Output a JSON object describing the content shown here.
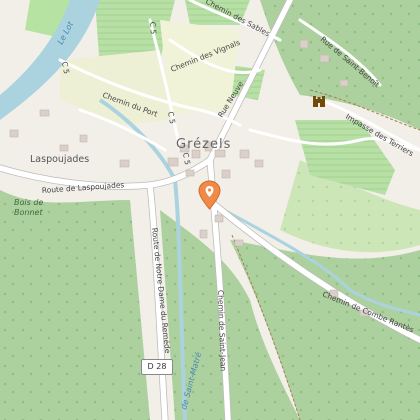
{
  "labels": {
    "village": "Grézels",
    "laspoujades": "Laspoujades",
    "bois_de_bonnet_1": "Bois de",
    "bois_de_bonnet_2": "Bonnet",
    "route_laspoujades": "Route de Laspoujades",
    "route_notre_dame": "Route de Notre Dame du Reméde",
    "chemin_port": "Chemin du Port",
    "rue_neuve": "Rue Neuve",
    "chemin_vignals": "Chemin des Vignals",
    "chemin_sables": "Chemin des Sables",
    "rue_st_benoit": "Rue de Saint-Benoît",
    "impasse_terriers": "Impasse des Terriers",
    "chemin_st_jean": "Chemin de Saint-Jean",
    "chemin_combe": "Chemin de Combe Rantès",
    "c5_a": "C 5",
    "c5_b": "C 5",
    "c5_c": "C 5",
    "c5_d": "C 5",
    "lot": "Le Lot",
    "stream": "de Saint-Matré",
    "road_shield": "D 28"
  },
  "icons": {
    "location_pin": "location-pin-icon",
    "castle": "castle-icon"
  },
  "colors": {
    "forest": "#aed1a0",
    "vineyard": "#b6e3a2",
    "farmland": "#eef0d5",
    "water": "#aad3df",
    "road": "#ffffff",
    "pin": "#f08a46"
  }
}
